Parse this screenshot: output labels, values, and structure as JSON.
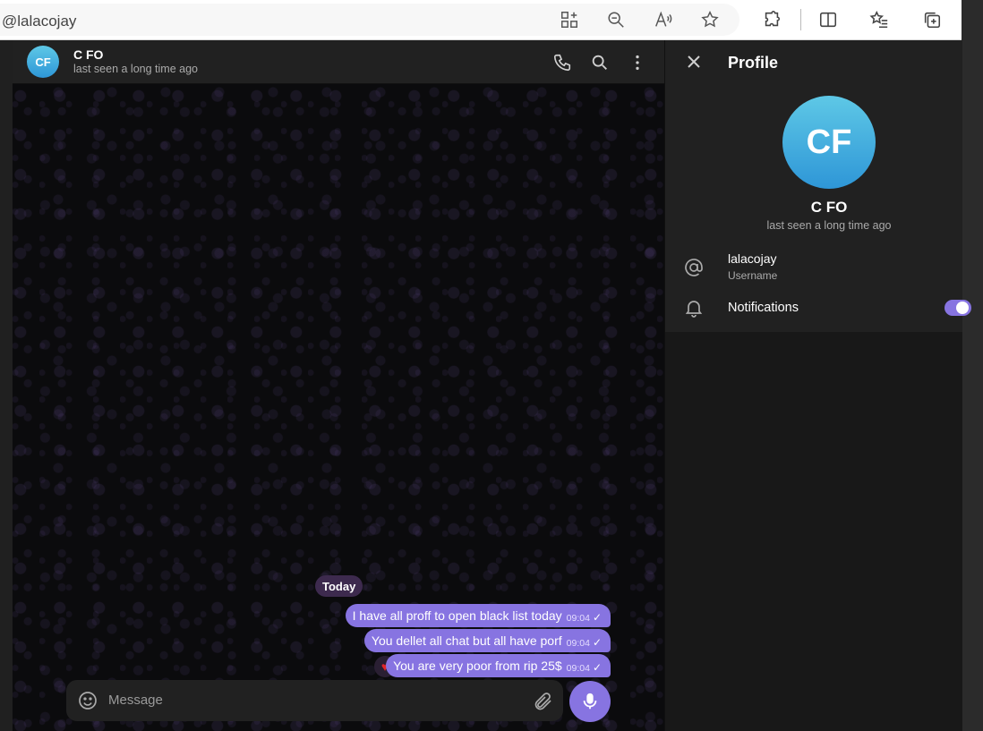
{
  "browser": {
    "address": "@lalacojay",
    "icons": [
      "app-available-icon",
      "zoom-out-icon",
      "read-aloud-icon",
      "favorite-star-icon",
      "extensions-icon",
      "split-screen-icon",
      "favorites-icon",
      "collections-icon"
    ]
  },
  "chat": {
    "header": {
      "avatar_initials": "CF",
      "name": "C FO",
      "status": "last seen a long time ago"
    },
    "date_label": "Today",
    "messages": [
      {
        "text": "I have all proff to open black list today",
        "time": "09:04",
        "check": "✓"
      },
      {
        "text": "You dellet all chat but all have porf",
        "time": "09:04",
        "check": "✓"
      },
      {
        "text": "You are very poor from rip 25$",
        "time": "09:04",
        "check": "✓",
        "reaction": "♥"
      }
    ],
    "composer": {
      "placeholder": "Message"
    }
  },
  "profile": {
    "title": "Profile",
    "avatar_initials": "CF",
    "name": "C FO",
    "status": "last seen a long time ago",
    "username": "lalacojay",
    "username_caption": "Username",
    "notifications_label": "Notifications",
    "notifications_on": true
  },
  "colors": {
    "accent": "#8774e1",
    "panel": "#212121",
    "avatar_gradient_top": "#5ec8e6",
    "avatar_gradient_bottom": "#2e96d7",
    "date_pill": "#3d2a4e"
  }
}
